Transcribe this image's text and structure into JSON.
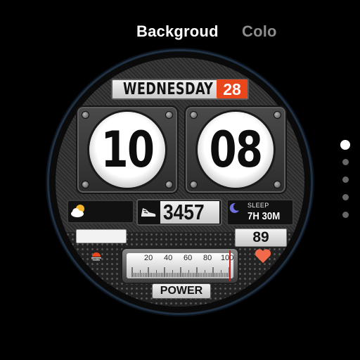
{
  "tabs": [
    {
      "label": "Backgroud",
      "active": true
    },
    {
      "label": "Colo",
      "active": false
    }
  ],
  "pager": {
    "count": 5,
    "active_index": 0
  },
  "watch": {
    "day": "WEDNESDAY",
    "date": "28",
    "hours": "10",
    "minutes": "08",
    "steps": "3457",
    "sleep_label": "SLEEP",
    "sleep_value": "7H 30M",
    "heart_rate": "89",
    "gauge": {
      "labels": [
        "20",
        "40",
        "60",
        "80",
        "100"
      ],
      "level": 100,
      "title": "POWER"
    }
  },
  "colors": {
    "accent": "#e9461c",
    "heart": "#f26a4a",
    "ring": "#1f3043",
    "needle": "#c0241a"
  },
  "icons": [
    "weather-partly-cloudy-icon",
    "shoe-icon",
    "moon-icon",
    "heart-icon",
    "sunset-icon"
  ]
}
